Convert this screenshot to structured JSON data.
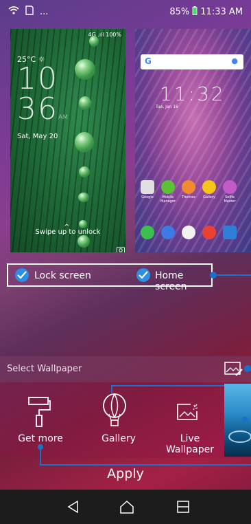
{
  "status_bar": {
    "overflow": "...",
    "battery": "85%",
    "time": "11:33 AM"
  },
  "lock_preview": {
    "status": "4G .ıll 100%",
    "temp": "25°C",
    "hour": "10",
    "minute": "36",
    "ampm": "AM",
    "date": "Sat, May 20",
    "swipe": "Swipe up to unlock"
  },
  "home_preview": {
    "time": "11:32",
    "date": "Tue, Jan 16",
    "apps": [
      {
        "label": "Google"
      },
      {
        "label": "Mobile Manager"
      },
      {
        "label": "Themes"
      },
      {
        "label": "Gallery"
      },
      {
        "label": "Selfie Master"
      }
    ]
  },
  "screen_select": {
    "lock_label": "Lock screen",
    "home_label": "Home screen"
  },
  "wallpaper": {
    "select_label": "Select Wallpaper",
    "options": [
      {
        "label": "Get more",
        "icon": "paint-roller-icon"
      },
      {
        "label": "Gallery",
        "icon": "balloon-icon"
      },
      {
        "label": "Live Wallpaper",
        "icon": "live-wallpaper-icon"
      }
    ],
    "apply_label": "Apply"
  },
  "colors": {
    "accent": "#2d8fe4",
    "callout": "#1b70c8",
    "navbar": "#1c1c1c"
  }
}
